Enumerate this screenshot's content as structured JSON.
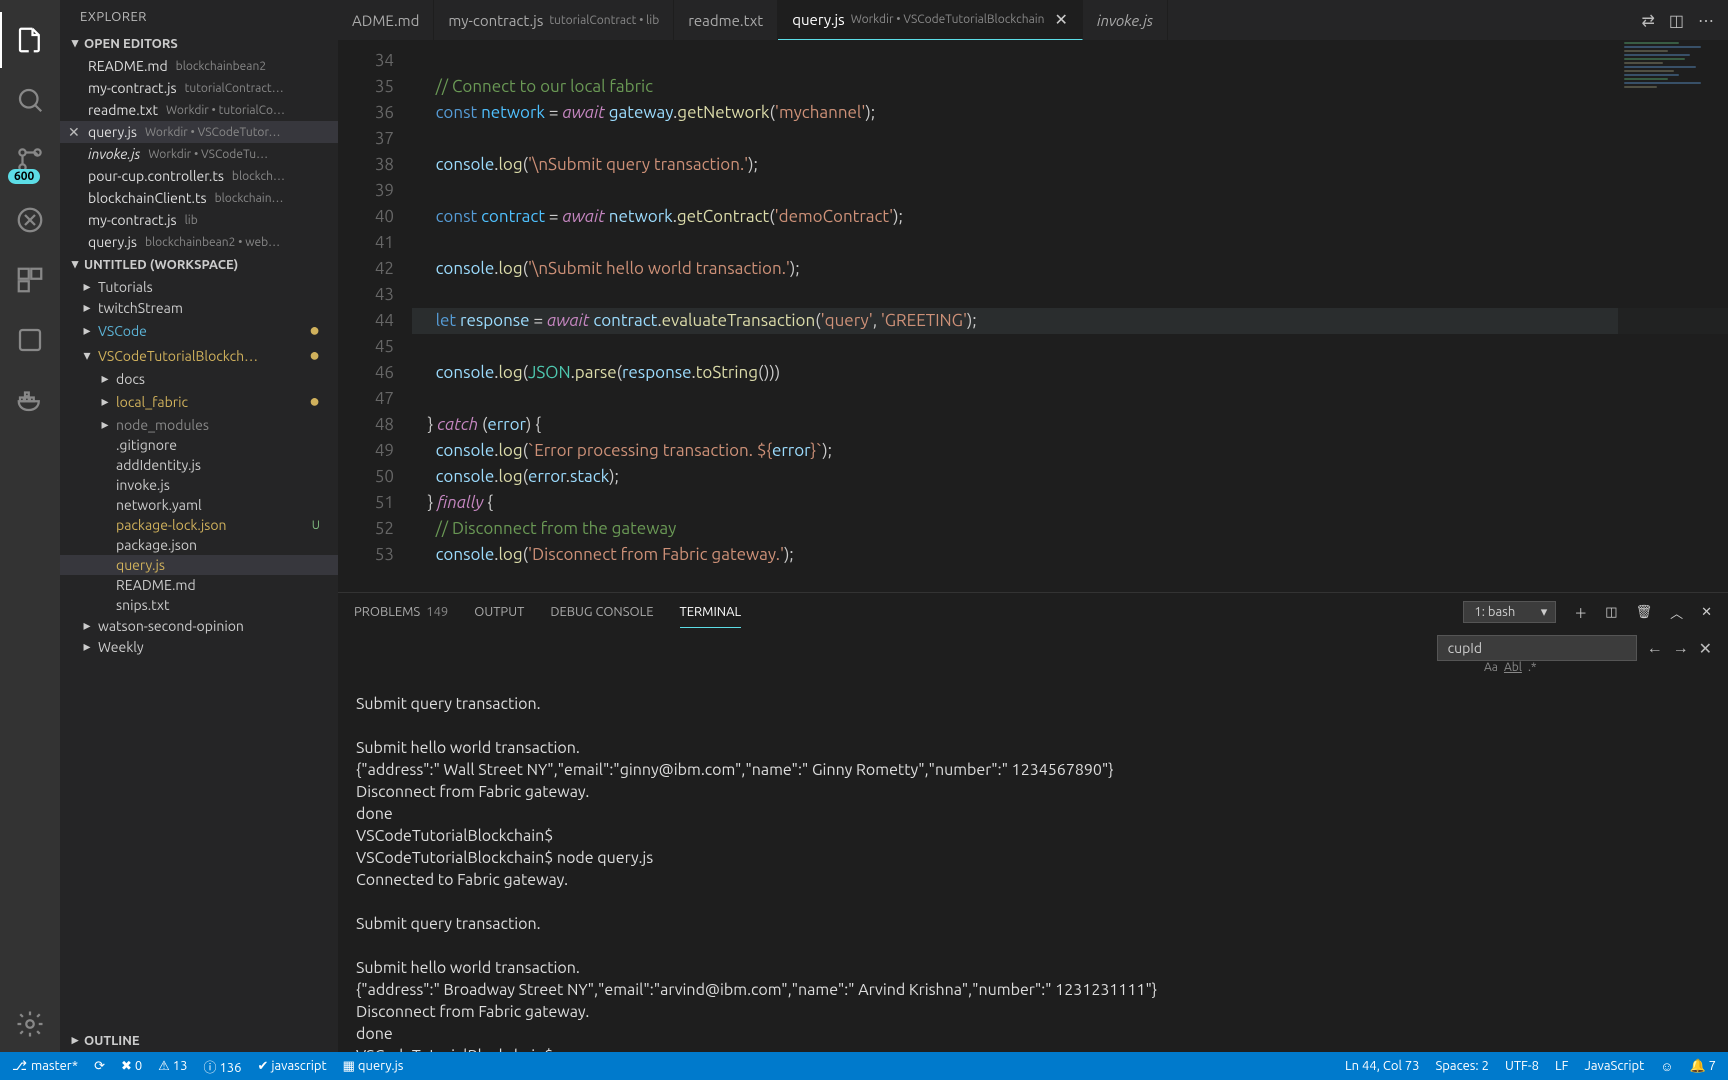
{
  "sidebar": {
    "title": "EXPLORER",
    "openEditorsHeader": "OPEN EDITORS",
    "openEditors": [
      {
        "name": "README.md",
        "desc": "blockchainbean2"
      },
      {
        "name": "my-contract.js",
        "desc": "tutorialContract…"
      },
      {
        "name": "readme.txt",
        "desc": "Workdir • tutorialCo…"
      },
      {
        "name": "query.js",
        "desc": "Workdir • VSCodeTutor…",
        "close": true,
        "selected": true
      },
      {
        "name": "invoke.js",
        "desc": "Workdir • VSCodeTu…",
        "italic": true
      },
      {
        "name": "pour-cup.controller.ts",
        "desc": "blockch…"
      },
      {
        "name": "blockchainClient.ts",
        "desc": "blockchain…"
      },
      {
        "name": "my-contract.js",
        "desc": "lib"
      },
      {
        "name": "query.js",
        "desc": "blockchainbean2 • web…"
      }
    ],
    "workspaceHeader": "UNTITLED (WORKSPACE)",
    "tree": [
      {
        "indent": 0,
        "kind": "folder",
        "label": "Tutorials",
        "chev": "▸"
      },
      {
        "indent": 0,
        "kind": "folder",
        "label": "twitchStream",
        "chev": "▸"
      },
      {
        "indent": 0,
        "kind": "folder",
        "label": "VSCode",
        "chev": "▸",
        "link": true,
        "dot": true
      },
      {
        "indent": 0,
        "kind": "folder",
        "label": "VSCodeTutorialBlockch…",
        "chev": "▾",
        "mod": true,
        "dot": true
      },
      {
        "indent": 1,
        "kind": "folder",
        "label": "docs",
        "chev": "▸"
      },
      {
        "indent": 1,
        "kind": "folder",
        "label": "local_fabric",
        "chev": "▸",
        "mod": true,
        "dot": true
      },
      {
        "indent": 1,
        "kind": "folder",
        "label": "node_modules",
        "chev": "▸",
        "dim": true
      },
      {
        "indent": 1,
        "kind": "file",
        "label": ".gitignore"
      },
      {
        "indent": 1,
        "kind": "file",
        "label": "addIdentity.js"
      },
      {
        "indent": 1,
        "kind": "file",
        "label": "invoke.js"
      },
      {
        "indent": 1,
        "kind": "file",
        "label": "network.yaml"
      },
      {
        "indent": 1,
        "kind": "file",
        "label": "package-lock.json",
        "mod": true,
        "u": "U"
      },
      {
        "indent": 1,
        "kind": "file",
        "label": "package.json"
      },
      {
        "indent": 1,
        "kind": "file",
        "label": "query.js",
        "mod": true,
        "selected": true
      },
      {
        "indent": 1,
        "kind": "file",
        "label": "README.md"
      },
      {
        "indent": 1,
        "kind": "file",
        "label": "snips.txt"
      },
      {
        "indent": 0,
        "kind": "folder",
        "label": "watson-second-opinion",
        "chev": "▸"
      },
      {
        "indent": 0,
        "kind": "folder",
        "label": "Weekly",
        "chev": "▸"
      }
    ],
    "outlineHeader": "OUTLINE"
  },
  "scmBadge": "600",
  "tabs": [
    {
      "label": "ADME.md"
    },
    {
      "label": "my-contract.js",
      "desc": "tutorialContract • lib"
    },
    {
      "label": "readme.txt"
    },
    {
      "label": "query.js",
      "desc": "Workdir • VSCodeTutorialBlockchain",
      "active": true,
      "close": true
    },
    {
      "label": "invoke.js",
      "italic": true
    }
  ],
  "editor": {
    "startLine": 34,
    "highlight": 44,
    "lines": [
      {
        "html": ""
      },
      {
        "html": "    <span class='c-comment'>// Connect to our local fabric</span>"
      },
      {
        "html": "    <span class='c-kw'>const</span> <span class='c-const'>network</span> = <span class='c-kw2'>await</span> <span class='c-var'>gateway</span>.<span class='c-func'>getNetwork</span>(<span class='c-str'>'mychannel'</span>);"
      },
      {
        "html": ""
      },
      {
        "html": "    <span class='c-var'>console</span>.<span class='c-func'>log</span>(<span class='c-str'>'\\nSubmit query transaction.'</span>);"
      },
      {
        "html": ""
      },
      {
        "html": "    <span class='c-kw'>const</span> <span class='c-const'>contract</span> = <span class='c-kw2'>await</span> <span class='c-var'>network</span>.<span class='c-func'>getContract</span>(<span class='c-str'>'demoContract'</span>);"
      },
      {
        "html": ""
      },
      {
        "html": "    <span class='c-var'>console</span>.<span class='c-func'>log</span>(<span class='c-str'>'\\nSubmit hello world transaction.'</span>);"
      },
      {
        "html": ""
      },
      {
        "html": "    <span class='c-kw'>let</span> <span class='c-var'>response</span> = <span class='c-kw2'>await</span> <span class='c-var'>contract</span>.<span class='c-func'>evaluateTransaction</span>(<span class='c-str'>'query'</span>, <span class='c-str'>'GREETING'</span>);"
      },
      {
        "html": ""
      },
      {
        "html": "    <span class='c-var'>console</span>.<span class='c-func'>log</span>(<span class='c-type'>JSON</span>.<span class='c-func'>parse</span>(<span class='c-var'>response</span>.<span class='c-func'>toString</span>()))"
      },
      {
        "html": ""
      },
      {
        "html": "  } <span class='c-kw2'>catch</span> (<span class='c-var'>error</span>) {"
      },
      {
        "html": "    <span class='c-var'>console</span>.<span class='c-func'>log</span>(<span class='c-str'>`Error processing transaction. ${</span><span class='c-var'>error</span><span class='c-str'>}`</span>);"
      },
      {
        "html": "    <span class='c-var'>console</span>.<span class='c-func'>log</span>(<span class='c-var'>error</span>.<span class='c-var'>stack</span>);"
      },
      {
        "html": "  } <span class='c-kw2'>finally</span> {"
      },
      {
        "html": "    <span class='c-comment'>// Disconnect from the gateway</span>"
      },
      {
        "html": "    <span class='c-var'>console</span>.<span class='c-func'>log</span>(<span class='c-str'>'Disconnect from Fabric gateway.'</span>);"
      }
    ]
  },
  "panel": {
    "tabs": {
      "problems": "PROBLEMS",
      "problemsCount": "149",
      "output": "OUTPUT",
      "debug": "DEBUG CONSOLE",
      "terminal": "TERMINAL"
    },
    "termSelect": "1: bash",
    "findValue": "cupId",
    "terminal": "\nSubmit query transaction.\n\nSubmit hello world transaction.\n{\"address\":\" Wall Street NY\",\"email\":\"ginny@ibm.com\",\"name\":\" Ginny Rometty\",\"number\":\" 1234567890\"}\nDisconnect from Fabric gateway.\ndone\nVSCodeTutorialBlockchain$\nVSCodeTutorialBlockchain$ node query.js\nConnected to Fabric gateway.\n\nSubmit query transaction.\n\nSubmit hello world transaction.\n{\"address\":\" Broadway Street NY\",\"email\":\"arvind@ibm.com\",\"name\":\" Arvind Krishna\",\"number\":\" 1231231111\"}\nDisconnect from Fabric gateway.\ndone\nVSCodeTutorialBlockchain$\nVSCodeTutorialBlockchain$ "
  },
  "status": {
    "branch": "master*",
    "sync": "⟳",
    "errors": "✖ 0",
    "warnings": "⚠ 13",
    "info": "ⓘ 136",
    "lang1": "✔ javascript",
    "lang2": "▦ query.js",
    "pos": "Ln 44, Col 73",
    "spaces": "Spaces: 2",
    "enc": "UTF-8",
    "eol": "LF",
    "mode": "JavaScript",
    "smile": "☺",
    "bell": "🔔 7"
  }
}
